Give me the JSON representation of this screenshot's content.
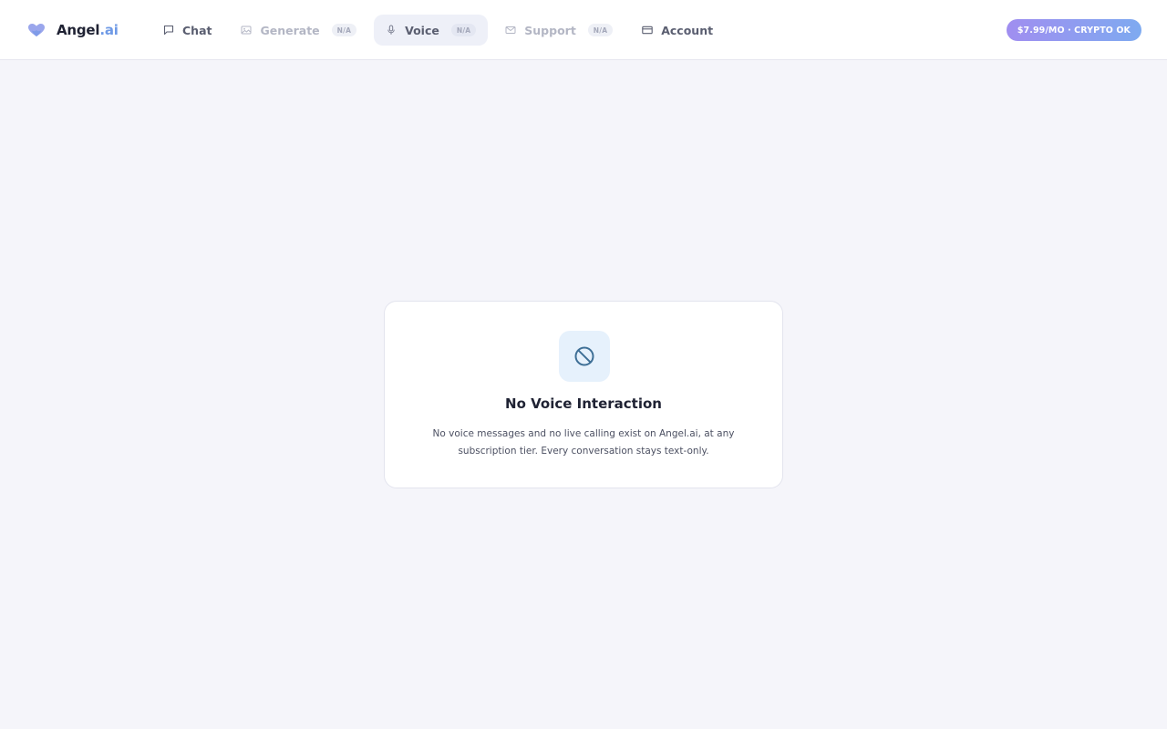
{
  "brand": {
    "name": "Angel",
    "suffix": ".ai",
    "logo_icon": "heart-icon"
  },
  "nav": {
    "items": [
      {
        "label": "Chat",
        "icon": "chat-bubble-icon",
        "state": "normal"
      },
      {
        "label": "Generate",
        "icon": "image-icon",
        "state": "disabled",
        "badge": "N/A"
      },
      {
        "label": "Voice",
        "icon": "microphone-icon",
        "state": "active",
        "badge": "N/A"
      },
      {
        "label": "Support",
        "icon": "mail-icon",
        "state": "disabled",
        "badge": "N/A"
      },
      {
        "label": "Account",
        "icon": "credit-card-icon",
        "state": "normal"
      }
    ]
  },
  "price_pill": {
    "label": "$7.99/MO · CRYPTO OK"
  },
  "notice": {
    "icon": "ban-icon",
    "title": "No Voice Interaction",
    "description": "No voice messages and no live calling exist on Angel.ai, at any subscription tier. Every conversation stays text-only."
  },
  "colors": {
    "accent_blue": "#6f9ae6",
    "accent_purple": "#a08ef0",
    "icon_box_bg": "#e6f1fc",
    "page_bg": "#f5f5fa"
  }
}
